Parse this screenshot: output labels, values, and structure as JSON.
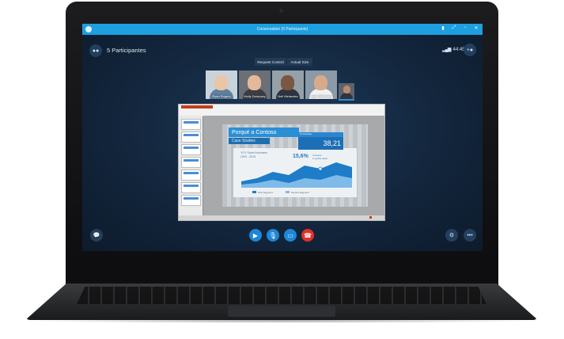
{
  "window": {
    "title": "Conversation (5 Participants)"
  },
  "header": {
    "participants_label": "5 Participantes",
    "signal_text": "44:45"
  },
  "controls": {
    "request_control": "Request Control",
    "actual_size": "Actual Size"
  },
  "participants": [
    {
      "name": "Ryan Rogers",
      "skin": "#e9c6a6",
      "shirt": "#5e7fa0",
      "bg": "#c9d3dc"
    },
    {
      "name": "Molly Dempsey",
      "skin": "#e3b99a",
      "shirt": "#3c3c44",
      "bg": "#6c6f75"
    },
    {
      "name": "Neil Melandez",
      "skin": "#7b5640",
      "shirt": "#2e3340",
      "bg": "#95a0a8"
    },
    {
      "name": "Jade McKinney",
      "skin": "#d8a98a",
      "shirt": "#f1f1f1",
      "bg": "#8c99a6"
    },
    {
      "name": "",
      "skin": "#b98a6c",
      "shirt": "#30343c",
      "bg": "#5c636c"
    }
  ],
  "slide": {
    "title": "Porqué a Contoso",
    "subtitle": "Case Studies",
    "chart_header": "YOY Sales Increases\n2009 - 2015",
    "kpi_value": "38,21",
    "kpi_label": "% Increase",
    "kpi2_value": "15,6%",
    "kpi2_label": "Increase\nin yearly sales",
    "legend": [
      "First Segment",
      "Second Segment"
    ]
  },
  "colors": {
    "accent": "#1e9fe0",
    "hangup": "#e0312b",
    "call_btn": "#1e86d6"
  },
  "icons": {
    "video": "video-camera-icon",
    "mic": "microphone-icon",
    "share": "screen-share-icon",
    "hangup": "hang-up-icon",
    "chat": "chat-icon",
    "people": "people-icon",
    "add_person": "add-person-icon",
    "more": "more-icon"
  }
}
